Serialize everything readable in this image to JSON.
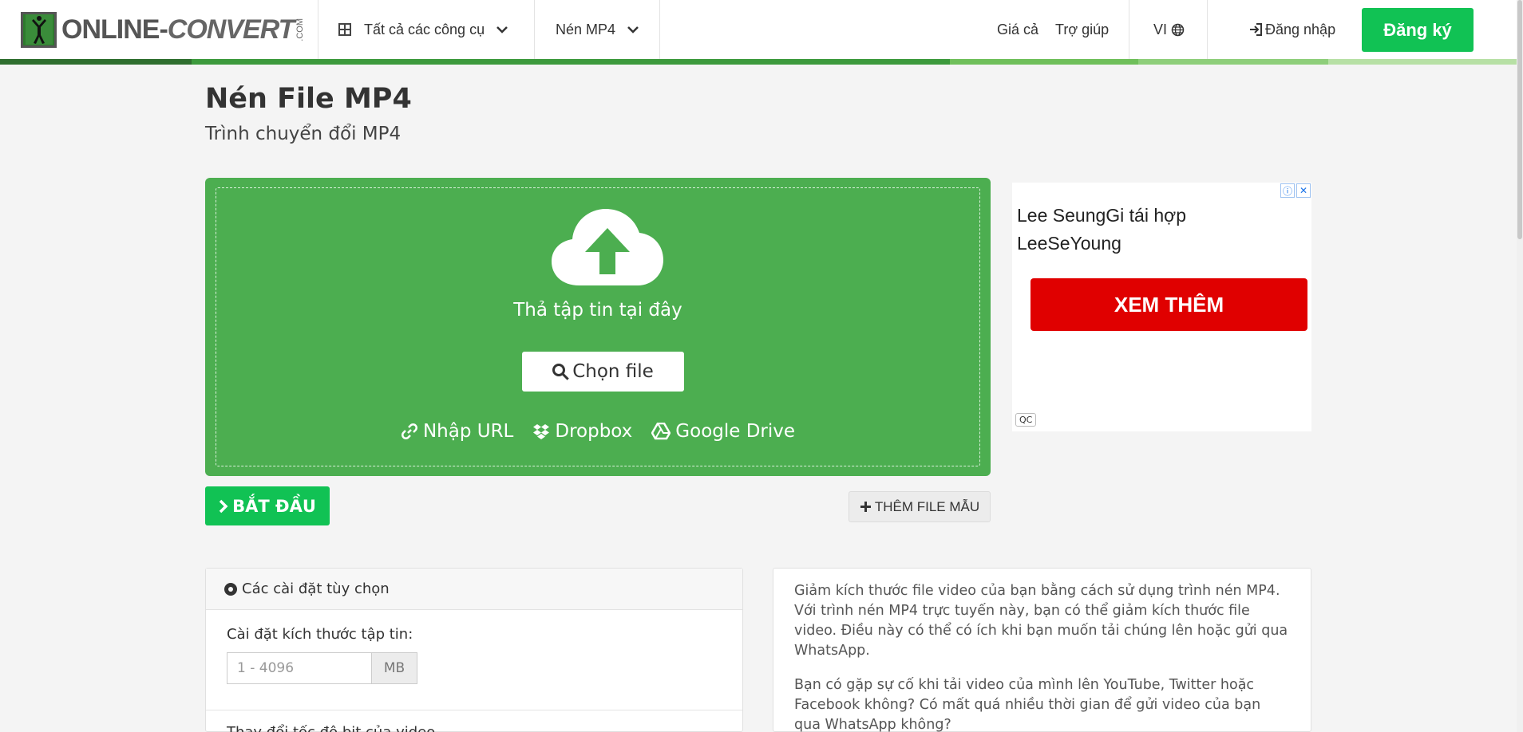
{
  "header": {
    "logo_text_main": "ONLINE",
    "logo_text_dash": "-",
    "logo_text_conv": "CONVERT",
    "logo_com": ".COM",
    "all_tools_label": "Tất cả các công cụ",
    "compress_mp4_label": "Nén MP4",
    "pricing_label": "Giá cả",
    "help_label": "Trợ giúp",
    "language_label": "VI",
    "login_label": "Đăng nhập",
    "signup_label": "Đăng ký"
  },
  "page": {
    "title": "Nén File MP4",
    "subtitle": "Trình chuyển đổi MP4"
  },
  "upload": {
    "drop_text": "Thả tập tin tại đây",
    "choose_file_label": "Chọn file",
    "url_label": "Nhập URL",
    "dropbox_label": "Dropbox",
    "gdrive_label": "Google Drive"
  },
  "actions": {
    "start_label": "BẮT ĐẦU",
    "add_sample_label": "THÊM FILE MẪU"
  },
  "ad": {
    "headline": "Lee SeungGi tái hợp LeeSeYoung",
    "cta_label": "XEM THÊM",
    "qc_label": "QC"
  },
  "settings": {
    "header": "Các cài đặt tùy chọn",
    "file_size_label": "Cài đặt kích thước tập tin:",
    "file_size_placeholder": "1 - 4096",
    "file_size_unit": "MB",
    "next_label": "Thay đổi tốc độ bit của video"
  },
  "description": {
    "paragraphs": [
      "Giảm kích thước file video của bạn bằng cách sử dụng trình nén MP4. Với trình nén MP4 trực tuyến này, bạn có thể giảm kích thước file video. Điều này có thể có ích khi bạn muốn tải chúng lên hoặc gửi qua WhatsApp.",
      "Bạn có gặp sự cố khi tải video của mình lên YouTube, Twitter hoặc Facebook không? Có mất quá nhiều thời gian để gửi video của bạn qua WhatsApp không?"
    ]
  },
  "colors": {
    "brand_green": "#11c254",
    "upload_green": "#4cae50",
    "ad_red": "#e00000"
  }
}
